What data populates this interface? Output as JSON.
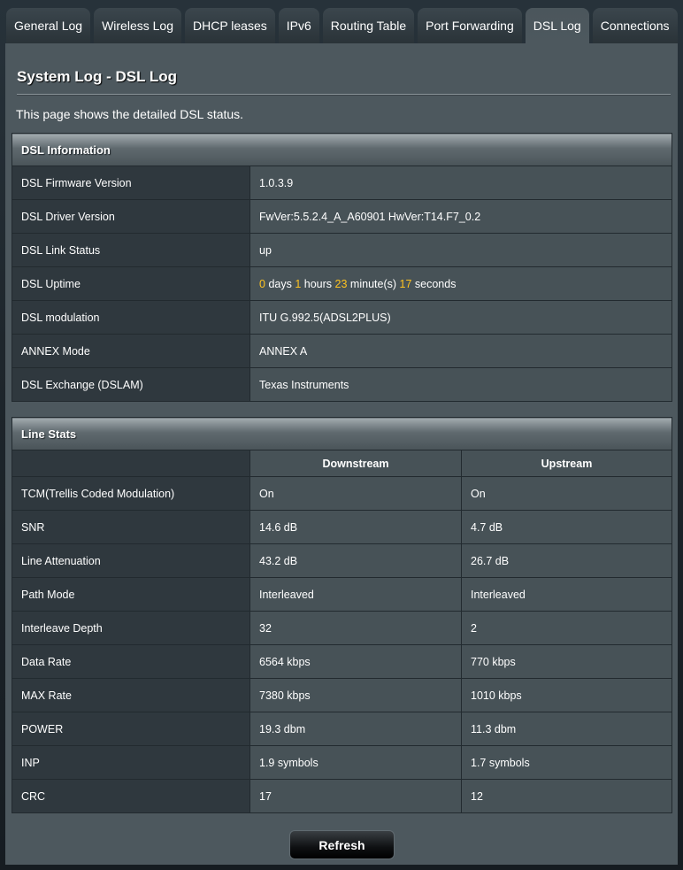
{
  "tabs": [
    {
      "label": "General Log",
      "active": false
    },
    {
      "label": "Wireless Log",
      "active": false
    },
    {
      "label": "DHCP leases",
      "active": false
    },
    {
      "label": "IPv6",
      "active": false
    },
    {
      "label": "Routing Table",
      "active": false
    },
    {
      "label": "Port Forwarding",
      "active": false
    },
    {
      "label": "DSL Log",
      "active": true
    },
    {
      "label": "Connections",
      "active": false
    }
  ],
  "page": {
    "title": "System Log - DSL Log",
    "description": "This page shows the detailed DSL status."
  },
  "dsl_info": {
    "heading": "DSL Information",
    "rows": [
      {
        "label": "DSL Firmware Version",
        "value": "1.0.3.9"
      },
      {
        "label": "DSL Driver Version",
        "value": "FwVer:5.5.2.4_A_A60901 HwVer:T14.F7_0.2"
      },
      {
        "label": "DSL Link Status",
        "value": "up"
      },
      {
        "label": "DSL Uptime",
        "value": ""
      },
      {
        "label": "DSL modulation",
        "value": "ITU G.992.5(ADSL2PLUS)"
      },
      {
        "label": "ANNEX Mode",
        "value": "ANNEX A"
      },
      {
        "label": "DSL Exchange (DSLAM)",
        "value": "Texas Instruments"
      }
    ],
    "uptime": {
      "days": "0",
      "days_label": "days",
      "hours": "1",
      "hours_label": "hours",
      "minutes": "23",
      "minutes_label": "minute(s)",
      "seconds": "17",
      "seconds_label": "seconds"
    }
  },
  "line_stats": {
    "heading": "Line Stats",
    "columns": [
      "Downstream",
      "Upstream"
    ],
    "rows": [
      {
        "label": "TCM(Trellis Coded Modulation)",
        "down": "On",
        "up": "On"
      },
      {
        "label": "SNR",
        "down": "14.6 dB",
        "up": "4.7 dB"
      },
      {
        "label": "Line Attenuation",
        "down": "43.2 dB",
        "up": "26.7 dB"
      },
      {
        "label": "Path Mode",
        "down": "Interleaved",
        "up": "Interleaved"
      },
      {
        "label": "Interleave Depth",
        "down": "32",
        "up": "2"
      },
      {
        "label": "Data Rate",
        "down": "6564 kbps",
        "up": "770 kbps"
      },
      {
        "label": "MAX Rate",
        "down": "7380 kbps",
        "up": "1010 kbps"
      },
      {
        "label": "POWER",
        "down": "19.3 dbm",
        "up": "11.3 dbm"
      },
      {
        "label": "INP",
        "down": "1.9 symbols",
        "up": "1.7 symbols"
      },
      {
        "label": "CRC",
        "down": "17",
        "up": "12"
      }
    ]
  },
  "actions": {
    "refresh_label": "Refresh"
  },
  "colors": {
    "accent_number": "#ffc320",
    "panel_bg": "#4d585e",
    "label_cell_bg": "#2f383e",
    "value_cell_bg": "#475257"
  }
}
